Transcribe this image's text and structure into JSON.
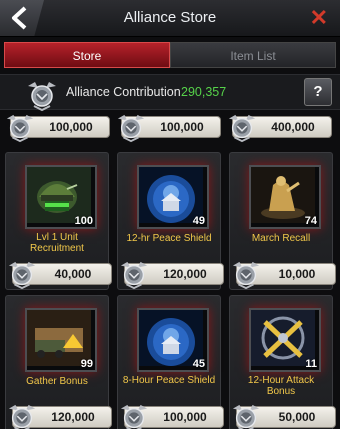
{
  "header": {
    "title": "Alliance Store",
    "back_icon": "back-arrow-icon",
    "close_icon": "close-icon"
  },
  "tabs": [
    {
      "label": "Store",
      "active": true
    },
    {
      "label": "Item List",
      "active": false
    }
  ],
  "contribution": {
    "label": "Alliance Contribution",
    "value": "290,357",
    "help_label": "?"
  },
  "top_prices": [
    "100,000",
    "100,000",
    "400,000"
  ],
  "items": [
    {
      "name": "Lvl 1 Unit Recruitment",
      "qty": "100",
      "price": "40,000",
      "icon": "unit-recruitment-helmet-icon"
    },
    {
      "name": "12-hr Peace Shield",
      "qty": "49",
      "price": "120,000",
      "icon": "peace-shield-icon"
    },
    {
      "name": "March Recall",
      "qty": "74",
      "price": "10,000",
      "icon": "march-recall-icon"
    },
    {
      "name": "Gather Bonus",
      "qty": "99",
      "price": "120,000",
      "icon": "gather-bonus-icon"
    },
    {
      "name": "8-Hour Peace Shield",
      "qty": "45",
      "price": "100,000",
      "icon": "peace-shield-icon"
    },
    {
      "name": "12-Hour Attack Bonus",
      "qty": "11",
      "price": "50,000",
      "icon": "attack-bonus-icon"
    }
  ],
  "colors": {
    "accent_red": "#b6222a",
    "contribution_green": "#56d24a",
    "item_name_gold": "#f2c84a"
  }
}
